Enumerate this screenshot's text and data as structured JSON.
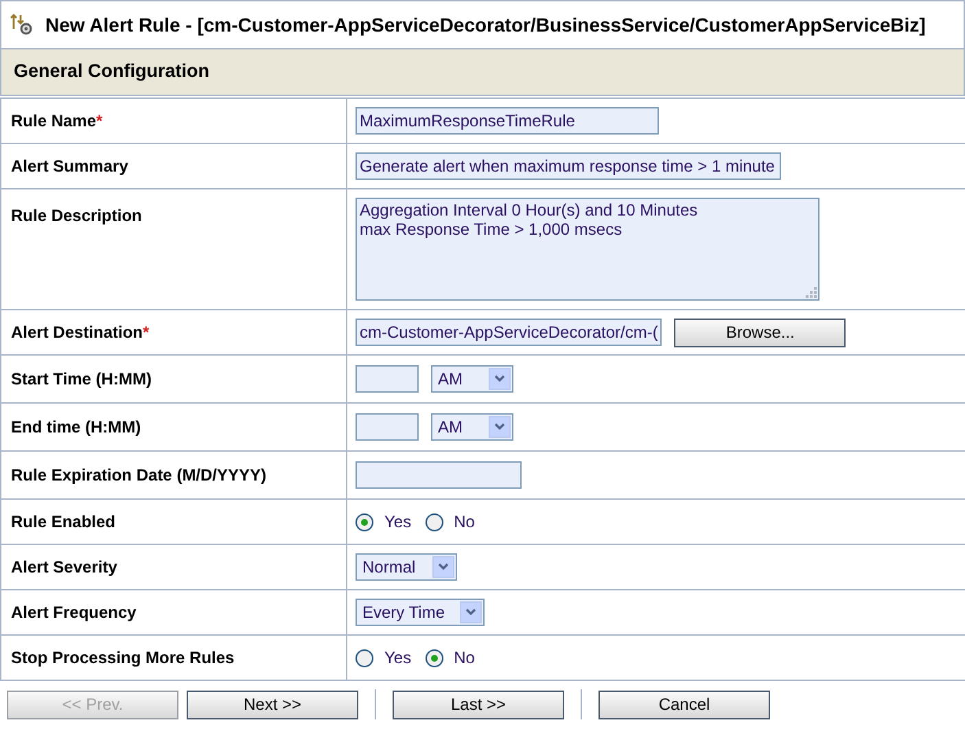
{
  "window": {
    "title": "New Alert Rule - [cm-Customer-AppServiceDecorator/BusinessService/CustomerAppServiceBiz]"
  },
  "section": {
    "title": "General Configuration"
  },
  "rows": [
    {
      "label": "Rule Name",
      "required_mark": "*",
      "kind": "text",
      "value": "MaximumResponseTimeRule"
    },
    {
      "label": "Alert Summary",
      "kind": "text",
      "value": "Generate alert when maximum response time > 1 minute"
    },
    {
      "label": "Rule Description",
      "kind": "textarea",
      "lines": [
        "Aggregation Interval 0 Hour(s) and 10 Minutes",
        "max Response Time > 1,000 msecs"
      ]
    },
    {
      "label": "Alert Destination",
      "required_mark": "*",
      "kind": "browse",
      "value": "cm-Customer-AppServiceDecorator/cm-(",
      "button": "Browse..."
    },
    {
      "label": "Start Time (H:MM)",
      "kind": "time",
      "select": "AM"
    },
    {
      "label": "End time (H:MM)",
      "kind": "time",
      "select": "AM"
    },
    {
      "label": "Rule Expiration Date (M/D/YYYY)",
      "kind": "date"
    },
    {
      "label": "Rule Enabled",
      "kind": "radio",
      "options": [
        {
          "label": "Yes",
          "selected": true
        },
        {
          "label": "No",
          "selected": false
        }
      ]
    },
    {
      "label": "Alert Severity",
      "kind": "select",
      "select": "Normal"
    },
    {
      "label": "Alert Frequency",
      "kind": "select",
      "select": "Every Time"
    },
    {
      "label": "Stop Processing More Rules",
      "kind": "radio",
      "options": [
        {
          "label": "Yes",
          "selected": false
        },
        {
          "label": "No",
          "selected": true
        }
      ]
    }
  ],
  "buttons": [
    {
      "label": "<< Prev.",
      "disabled": true
    },
    {
      "label": "Next >>",
      "disabled": false
    },
    {
      "label": "Last >>",
      "disabled": false
    },
    {
      "label": "Cancel",
      "disabled": false
    }
  ]
}
